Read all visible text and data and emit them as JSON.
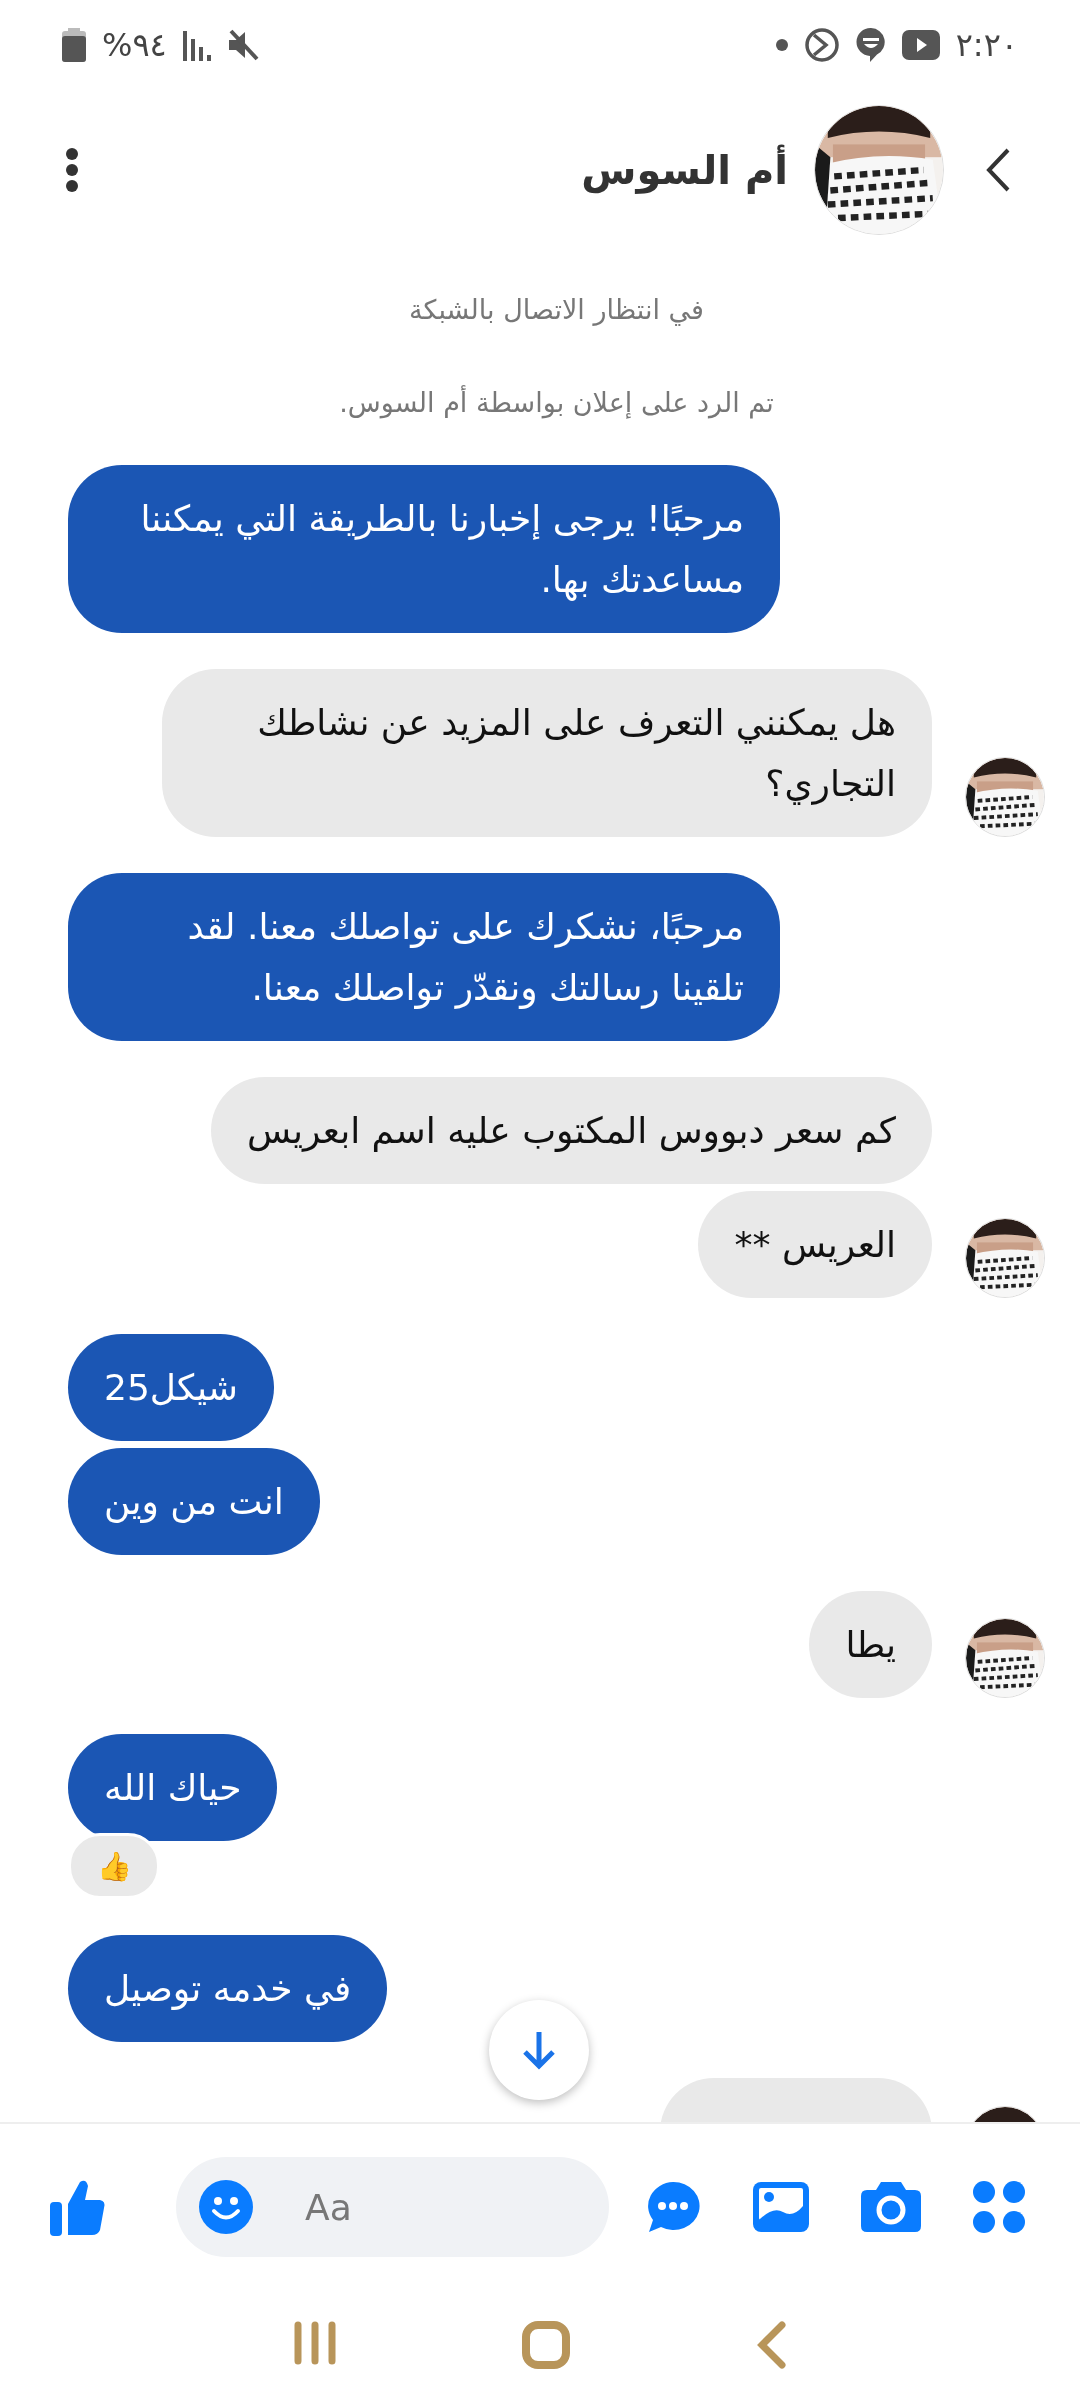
{
  "status_bar": {
    "time": "٢:٢٠",
    "battery": "%٩٤"
  },
  "header": {
    "title": "أم السوس"
  },
  "notices": [
    "في انتظار الاتصال بالشبكة",
    "تم الرد على إعلان بواسطة أم السوس."
  ],
  "messages": [
    {
      "kind": "sent",
      "text": "مرحبًا! يرجى إخبارنا بالطريقة التي يمكننا مساعدتك بها."
    },
    {
      "kind": "received",
      "text": "هل يمكنني التعرف على المزيد عن نشاطك التجاري؟",
      "show_avatar": true
    },
    {
      "kind": "sent",
      "text": "مرحبًا، نشكرك على تواصلك معنا. لقد تلقينا رسالتك ونقدّر تواصلك معنا."
    },
    {
      "kind": "received",
      "text": "كم سعر دبووس المكتوب عليه اسم ابعريس",
      "show_avatar": false
    },
    {
      "kind": "received",
      "text": "العريس **",
      "show_avatar": true
    },
    {
      "kind": "sent",
      "text": "شيكل25"
    },
    {
      "kind": "sent",
      "text": "انت من وين"
    },
    {
      "kind": "received",
      "text": "يطا",
      "show_avatar": true
    },
    {
      "kind": "sent",
      "text": "حياك الله",
      "reaction": "👍"
    },
    {
      "kind": "sent",
      "text": "في خدمه توصيل"
    },
    {
      "kind": "partial",
      "show_avatar": true
    }
  ],
  "composer": {
    "placeholder": "Aa"
  }
}
